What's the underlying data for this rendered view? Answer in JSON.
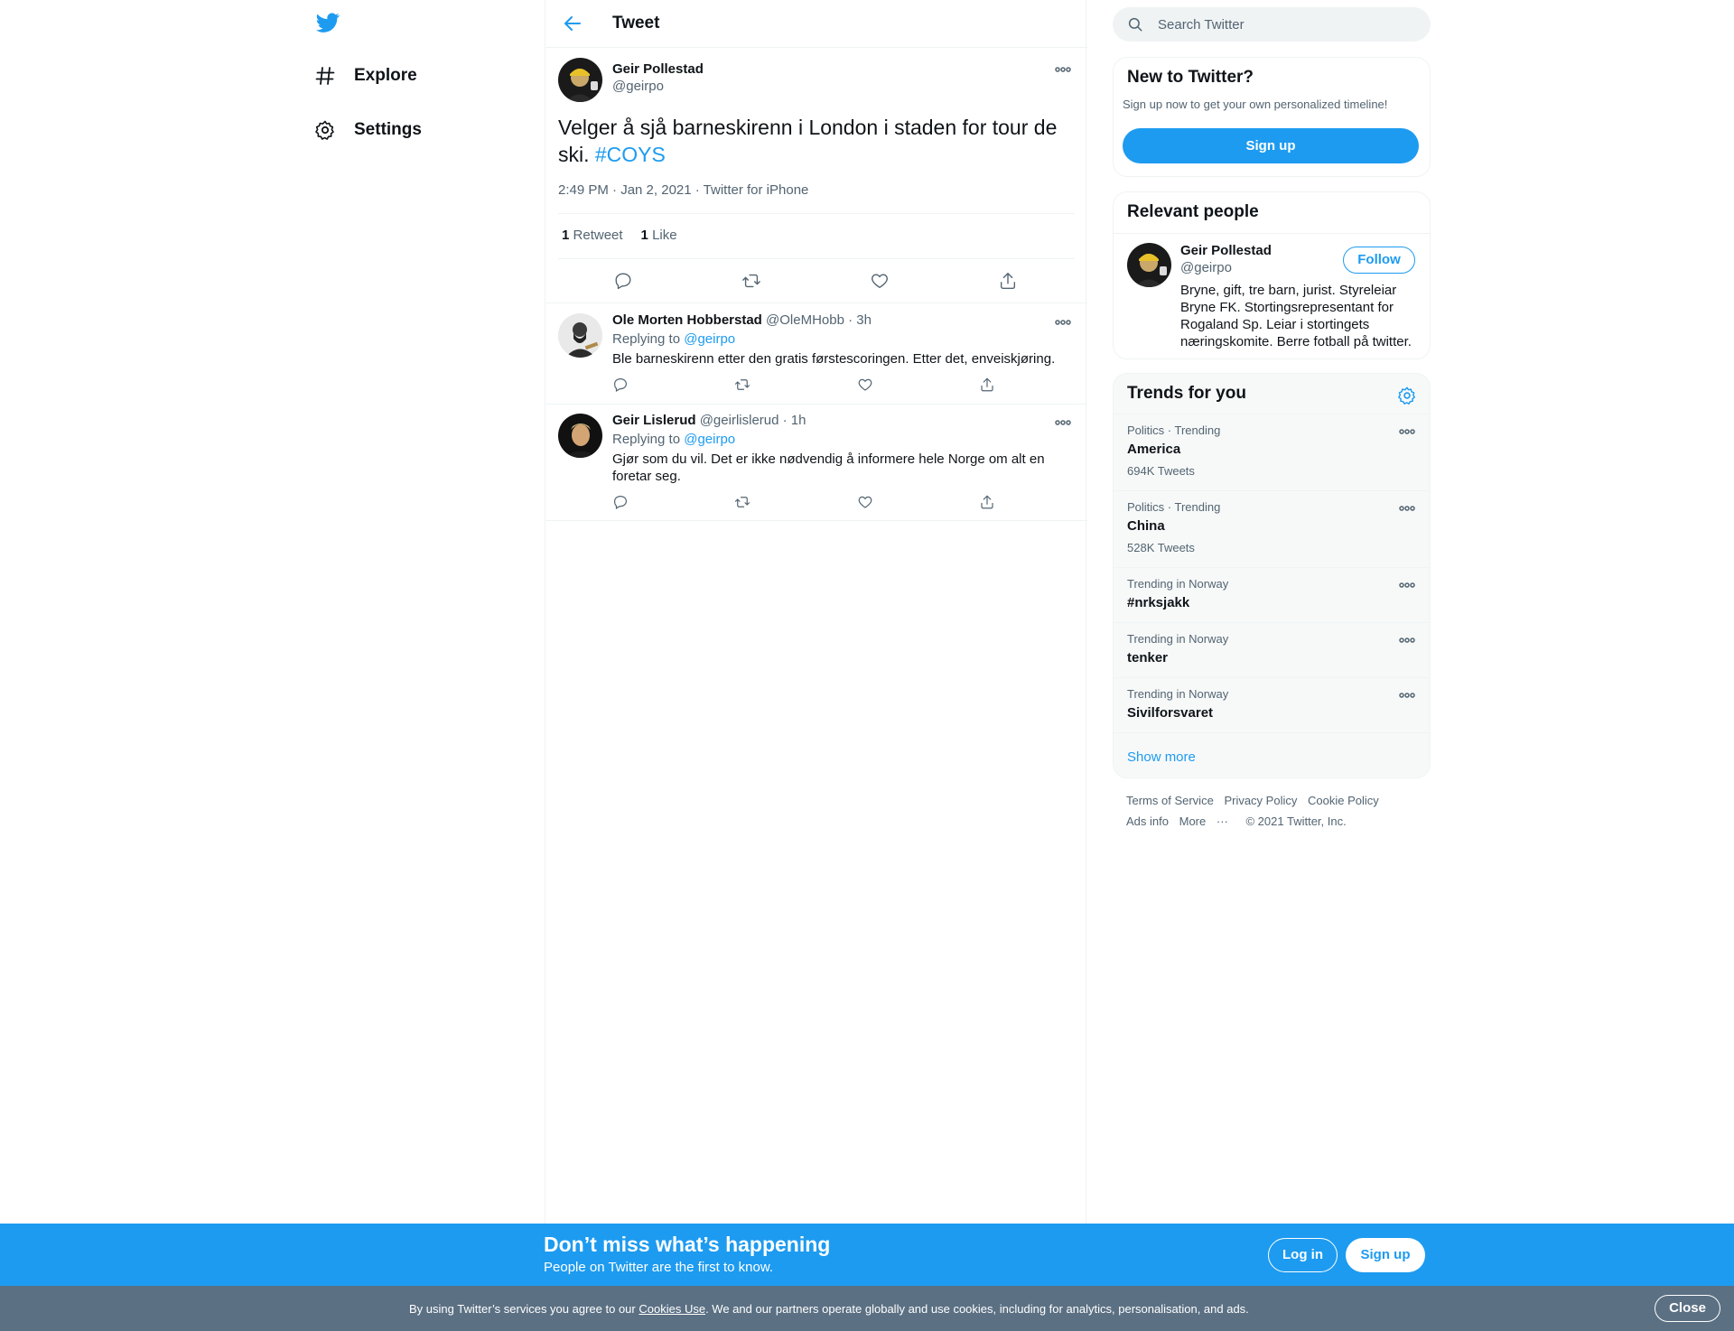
{
  "nav": {
    "logo_icon": "twitter-bird-icon",
    "items": [
      {
        "label": "Explore",
        "icon": "hashtag-icon"
      },
      {
        "label": "Settings",
        "icon": "gear-icon"
      }
    ]
  },
  "header": {
    "title": "Tweet",
    "back_icon": "arrow-left-icon"
  },
  "main_tweet": {
    "name": "Geir Pollestad",
    "handle": "@geirpo",
    "text": "Velger å sjå barneskirenn i London i staden for tour de ski.",
    "hashtag": "#COYS",
    "time": "2:49 PM · Jan 2, 2021",
    "source": "Twitter for iPhone",
    "retweets_count": "1",
    "retweets_label": "Retweet",
    "likes_count": "1",
    "likes_label": "Like"
  },
  "replies": [
    {
      "name": "Ole Morten Hobberstad",
      "handle": "@OleMHobb",
      "time": "· 3h",
      "replying_prefix": "Replying to",
      "replying_to": "@geirpo",
      "text": "Ble barneskirenn etter den gratis førstescoringen. Etter det, enveiskjøring."
    },
    {
      "name": "Geir Lislerud",
      "handle": "@geirlislerud",
      "time": "· 1h",
      "replying_prefix": "Replying to",
      "replying_to": "@geirpo",
      "text": "Gjør som du vil. Det er ikke nødvendig å informere hele Norge om alt en foretar seg."
    }
  ],
  "search": {
    "placeholder": "Search Twitter"
  },
  "new_to_twitter": {
    "title": "New to Twitter?",
    "subtitle": "Sign up now to get your own personalized timeline!",
    "button": "Sign up"
  },
  "relevant_people": {
    "title": "Relevant people",
    "name": "Geir Pollestad",
    "handle": "@geirpo",
    "follow": "Follow",
    "bio": "Bryne, gift, tre barn, jurist. Styreleiar Bryne FK. Stortingsrepresentant for Rogaland Sp. Leiar i stortingets næringskomite. Berre fotball på twitter."
  },
  "trends": {
    "title": "Trends for you",
    "items": [
      {
        "meta": "Politics · Trending",
        "name": "America",
        "count": "694K Tweets"
      },
      {
        "meta": "Politics · Trending",
        "name": "China",
        "count": "528K Tweets"
      },
      {
        "meta": "Trending in Norway",
        "name": "#nrksjakk"
      },
      {
        "meta": "Trending in Norway",
        "name": "tenker"
      },
      {
        "meta": "Trending in Norway",
        "name": "Sivilforsvaret"
      }
    ],
    "show_more": "Show more"
  },
  "footer": {
    "links": [
      "Terms of Service",
      "Privacy Policy",
      "Cookie Policy",
      "Ads info",
      "More"
    ],
    "copyright": "© 2021 Twitter, Inc."
  },
  "banner": {
    "title": "Don’t miss what’s happening",
    "subtitle": "People on Twitter are the first to know.",
    "login": "Log in",
    "signup": "Sign up"
  },
  "cookie": {
    "text_before": "By using Twitter’s services you agree to our ",
    "link": "Cookies Use",
    "text_after": ". We and our partners operate globally and use cookies, including for analytics, personalisation, and ads.",
    "close": "Close"
  },
  "colors": {
    "accent": "#1d9bf0",
    "text": "#0f1419",
    "secondary": "#536471",
    "cookie_bg": "#5b7083"
  }
}
